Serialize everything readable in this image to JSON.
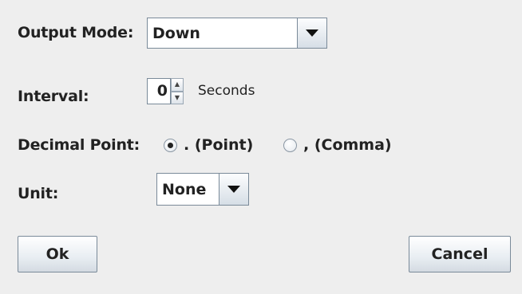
{
  "output_mode": {
    "label": "Output Mode:",
    "value": "Down"
  },
  "interval": {
    "label": "Interval:",
    "value": "0",
    "unit": "Seconds"
  },
  "decimal_point": {
    "label": "Decimal Point:",
    "options": [
      {
        "label": ". (Point)",
        "selected": true
      },
      {
        "label": ", (Comma)",
        "selected": false
      }
    ]
  },
  "unit": {
    "label": "Unit:",
    "value": "None"
  },
  "buttons": {
    "ok": "Ok",
    "cancel": "Cancel"
  },
  "icons": {
    "dropdown": "chevron-down-icon",
    "spin_up": "spin-up-icon",
    "spin_down": "spin-down-icon"
  }
}
